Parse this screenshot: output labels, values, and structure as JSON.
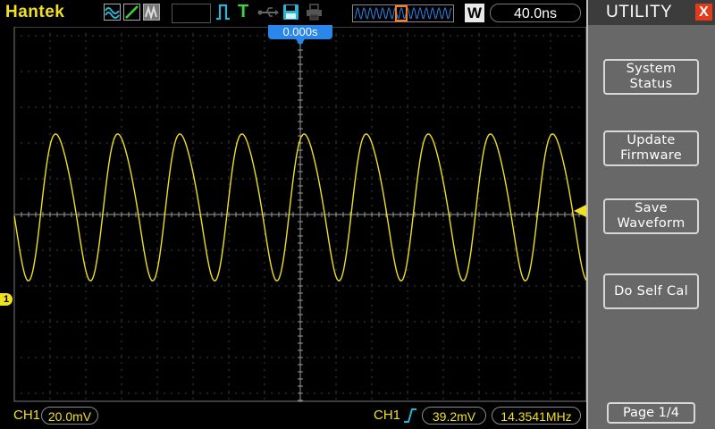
{
  "header": {
    "brand": "Hantek",
    "trigger_mode": "T",
    "timebase_mode": "W",
    "timebase": "40.0ns",
    "trigger_position": "0.000s"
  },
  "channel": {
    "marker": "1",
    "label": "CH1",
    "volts_div": "20.0mV"
  },
  "trigger": {
    "source": "CH1",
    "level": "39.2mV",
    "frequency": "14.3541MHz"
  },
  "menu": {
    "title": "UTILITY",
    "close": "X",
    "buttons": [
      {
        "label": "System\nStatus"
      },
      {
        "label": "Update\nFirmware"
      },
      {
        "label": "Save\nWaveform"
      },
      {
        "label": "Do Self Cal"
      }
    ],
    "page": "Page 1/4"
  },
  "colors": {
    "trace": "#f0e020",
    "trigger_marker": "#2a86e8",
    "accent_icons": "#2ab5d8",
    "close_button": "#e23a1c",
    "panel": "#686868"
  },
  "icons": [
    "acquire-mode-icon",
    "run-icon",
    "display-mode-icon",
    "trigger-edge-icon",
    "trigger-icon",
    "usb-icon",
    "save-icon",
    "printer-icon"
  ]
}
